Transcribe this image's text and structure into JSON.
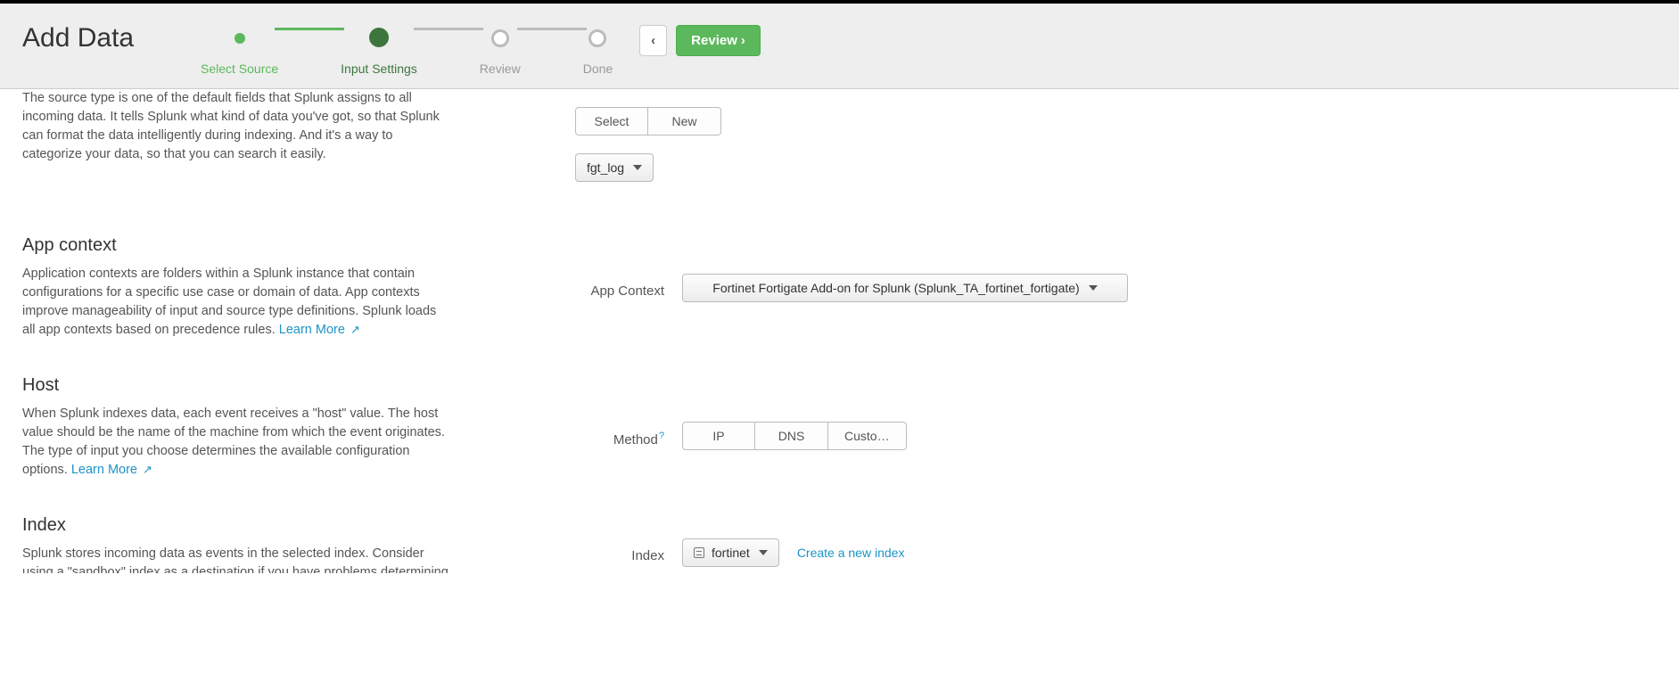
{
  "header": {
    "title": "Add Data",
    "steps": {
      "select_source": "Select Source",
      "input_settings": "Input Settings",
      "review": "Review",
      "done": "Done"
    },
    "back_icon": "‹",
    "review_button": "Review",
    "review_chevron": "›"
  },
  "source_type": {
    "desc": "The source type is one of the default fields that Splunk assigns to all incoming data. It tells Splunk what kind of data you've got, so that Splunk can format the data intelligently during indexing. And it's a way to categorize your data, so that you can search it easily.",
    "select_btn": "Select",
    "new_btn": "New",
    "dropdown_value": "fgt_log"
  },
  "app_context": {
    "title": "App context",
    "desc": "Application contexts are folders within a Splunk instance that contain configurations for a specific use case or domain of data. App contexts improve manageability of input and source type definitions. Splunk loads all app contexts based on precedence rules. ",
    "learn_more": "Learn More",
    "right_label": "App Context",
    "dropdown_value": "Fortinet Fortigate Add-on for Splunk (Splunk_TA_fortinet_fortigate)"
  },
  "host": {
    "title": "Host",
    "desc": "When Splunk indexes data, each event receives a \"host\" value. The host value should be the name of the machine from which the event originates. The type of input you choose determines the available configuration options. ",
    "learn_more": "Learn More",
    "right_label": "Method",
    "option_ip": "IP",
    "option_dns": "DNS",
    "option_custom": "Custo…"
  },
  "index": {
    "title": "Index",
    "desc": "Splunk stores incoming data as events in the selected index. Consider using a \"sandbox\" index as a destination if you have problems determining a source type for your data. A sandbox index lets you troubleshoot your configuration without impacting production indexes. You can always",
    "right_label": "Index",
    "dropdown_value": "fortinet",
    "create_link": "Create a new index"
  }
}
